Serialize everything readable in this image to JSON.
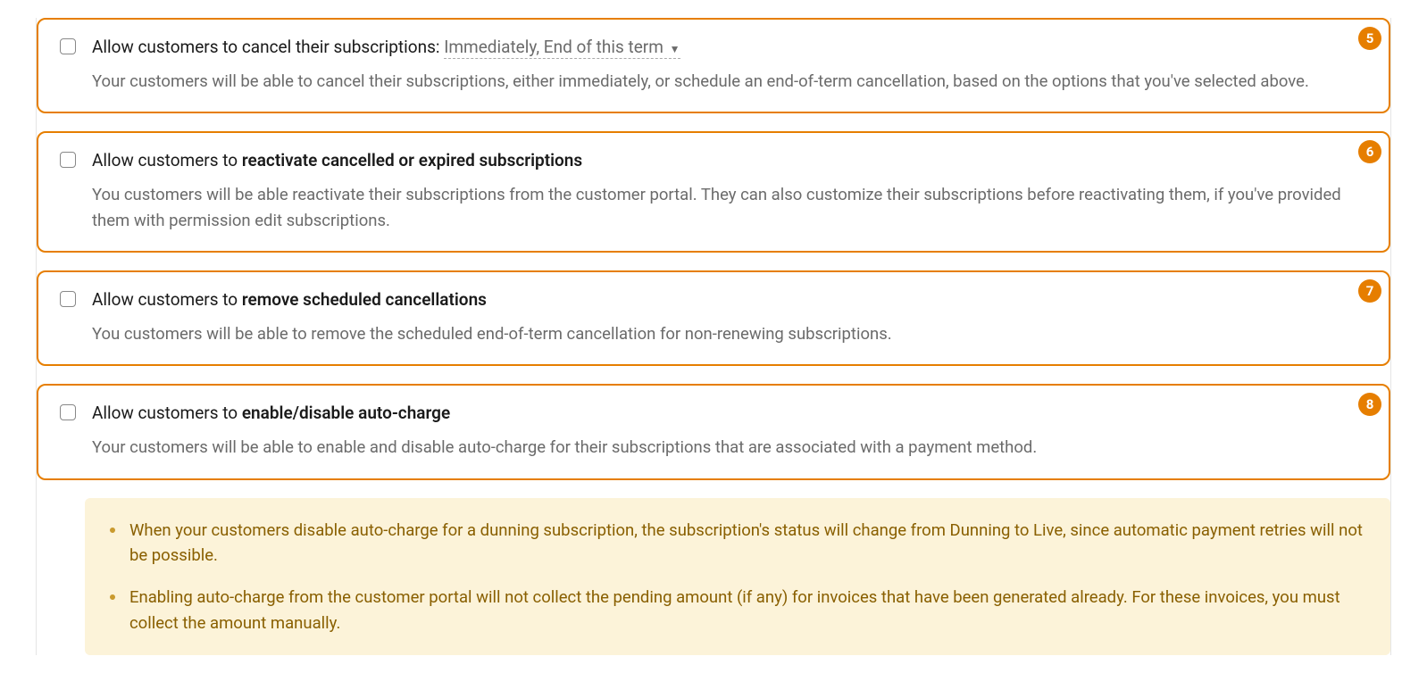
{
  "options": [
    {
      "badge": "5",
      "title_prefix": "Allow customers to cancel their subscriptions: ",
      "title_bold": "",
      "dropdown": "Immediately, End of this term",
      "desc": "Your customers will be able to cancel their subscriptions, either immediately, or schedule an end-of-term cancellation, based on the options that you've selected above."
    },
    {
      "badge": "6",
      "title_prefix": "Allow customers to ",
      "title_bold": "reactivate cancelled or expired subscriptions",
      "desc": "You customers will be able reactivate their subscriptions from the customer portal. They can also customize their subscriptions before reactivating them, if you've provided them with permission edit subscriptions."
    },
    {
      "badge": "7",
      "title_prefix": "Allow customers to ",
      "title_bold": "remove scheduled cancellations",
      "desc": "You customers will be able to remove the scheduled end-of-term cancellation for non-renewing subscriptions."
    },
    {
      "badge": "8",
      "title_prefix": "Allow customers to ",
      "title_bold": "enable/disable auto-charge",
      "desc": "Your customers will be able to enable and disable auto-charge for their subscriptions that are associated with a payment method."
    }
  ],
  "info_notes": [
    "When your customers disable auto-charge for a dunning subscription, the subscription's status will change from Dunning to Live, since automatic payment retries will not be possible.",
    "Enabling auto-charge from the customer portal will not collect the pending amount (if any) for invoices that have been generated already. For these invoices, you must collect the amount manually."
  ]
}
